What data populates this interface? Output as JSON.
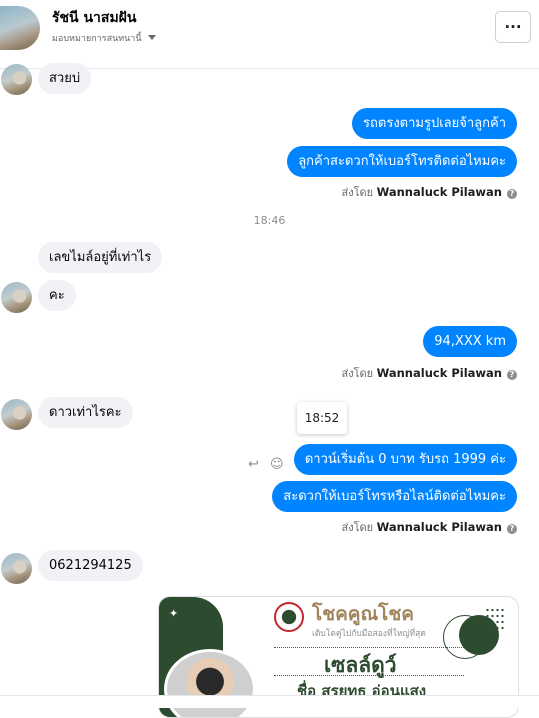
{
  "header": {
    "contact_name": "รัชนี นาสมฝัน",
    "assign_label": "มอบหมายการสนทนานี้",
    "more_label": "···"
  },
  "messages": {
    "m1": "สวยบ่",
    "m2": "รถตรงตามรูปเลยจ้าลูกค้า",
    "m3": "ลูกค้าสะดวกให้เบอร์โทรติดต่อไหมคะ",
    "m4": "เลขไมล์อยู่ที่เท่าไร",
    "m5": "คะ",
    "m6": "94,XXX  km",
    "m7": "ดาวเท่าไรคะ",
    "m8": "ดาวน์เริ่มต้น 0 บาท รับรถ 1999 ค่ะ",
    "m9": "สะดวกให้เบอร์โทรหรือไลน์ติดต่อไหมคะ",
    "m10": "0621294125"
  },
  "sent_by": {
    "prefix": "ส่งโดย",
    "name": "Wannaluck Pilawan",
    "info": "?"
  },
  "timestamp": "18:46",
  "tooltip_time": "18:52",
  "card": {
    "star": "✦",
    "brand": "โชคคูณโชค",
    "tagline": "เติบโตคู่ไปกับมือสองที่ใหญ่ที่สุด",
    "title": "เซลล์ดูว์",
    "name_line": "ชื่อ สรยุทธ  อ่อนแสง"
  },
  "icons": {
    "reply": "↩",
    "react": "☺"
  }
}
